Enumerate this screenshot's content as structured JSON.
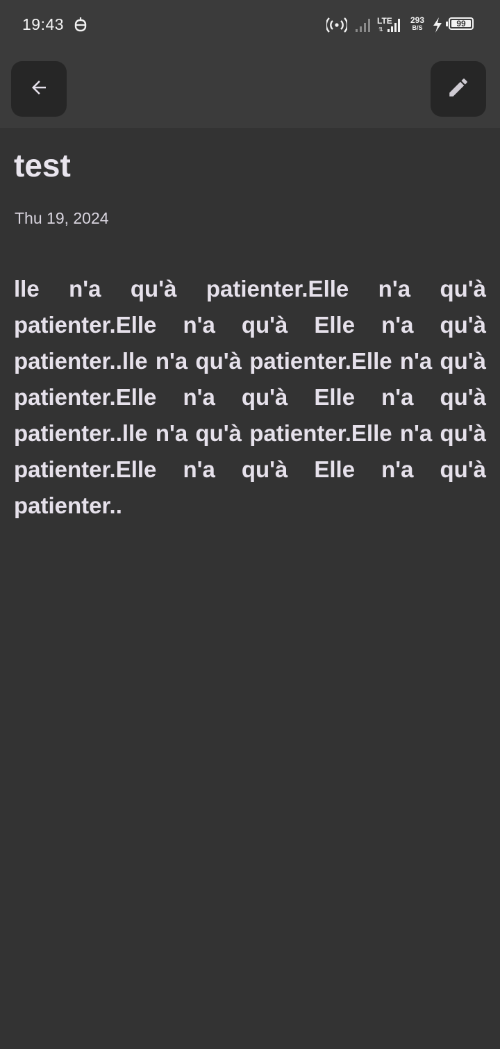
{
  "status_bar": {
    "time": "19:43",
    "network_type": "LTE",
    "speed_value": "293",
    "speed_unit": "B/S",
    "battery_level": "99",
    "icons": [
      "alarm-icon",
      "hotspot-icon",
      "signal-icon",
      "lte-signal-icon",
      "charging-icon",
      "battery-icon"
    ]
  },
  "app_bar": {
    "back_icon": "arrow-back-icon",
    "edit_icon": "pencil-icon"
  },
  "note": {
    "title": "test",
    "date": "Thu 19, 2024",
    "body": "lle n'a qu'à patienter.Elle n'a qu'à patienter.Elle n'a qu'à Elle n'a qu'à patienter..lle n'a qu'à patienter.Elle n'a qu'à patienter.Elle n'a qu'à Elle n'a qu'à patienter..lle n'a qu'à patienter.Elle n'a qu'à patienter.Elle n'a qu'à Elle n'a qu'à patienter.."
  },
  "colors": {
    "background": "#333333",
    "top_bar": "#3b3b3b",
    "button_bg": "#262626",
    "text": "#e6e1eb"
  }
}
